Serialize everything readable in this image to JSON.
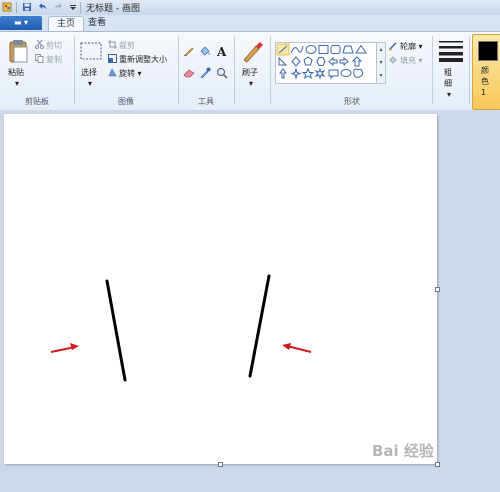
{
  "titlebar": {
    "title": "无标题 - 画图"
  },
  "tabs": {
    "file_label": "▬ ▾",
    "home": "主页",
    "view": "查看"
  },
  "clipboard": {
    "paste": "粘贴",
    "cut": "剪切",
    "copy": "复制",
    "group_label": "剪贴板"
  },
  "image": {
    "select": "选择",
    "crop": "裁剪",
    "resize": "重新调整大小",
    "rotate": "旋转 ▾",
    "group_label": "图像"
  },
  "tools": {
    "group_label": "工具"
  },
  "brushes": {
    "label": "刷子"
  },
  "shapes": {
    "outline": "轮廓 ▾",
    "fill": "填充 ▾",
    "group_label": "形状"
  },
  "size": {
    "label": "粗细"
  },
  "color1": {
    "label": "颜色 1",
    "value": "#000000"
  },
  "canvas": {
    "line_color": "#000000",
    "arrow_color": "#d11b1b"
  },
  "watermark": {
    "text": "Bai 经验"
  }
}
